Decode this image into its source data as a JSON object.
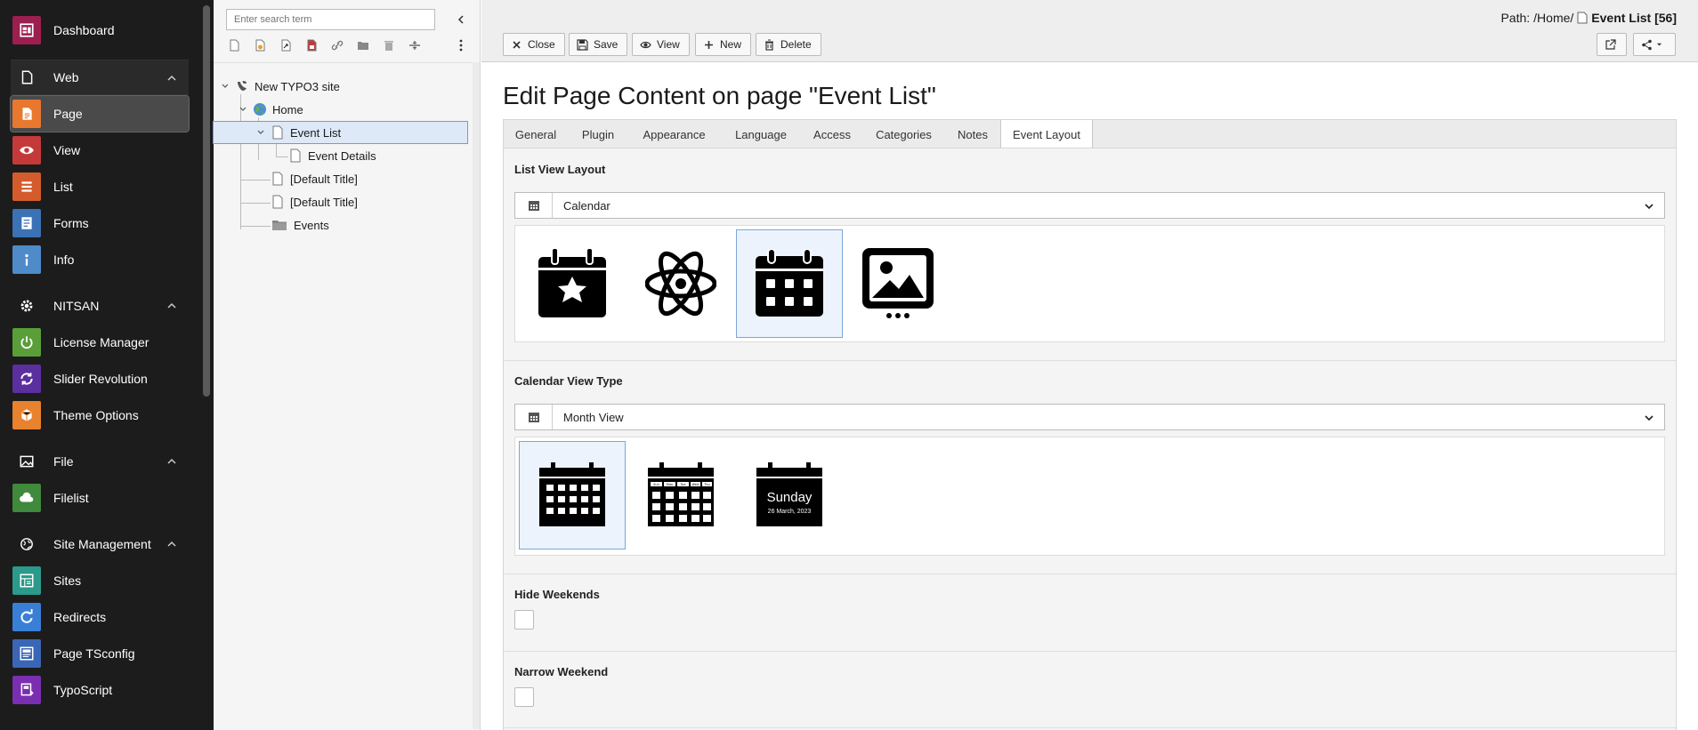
{
  "module_menu": {
    "items": [
      {
        "label": "Dashboard",
        "icon": "dashboard-icon",
        "color": "#9c1f4f",
        "type": "item"
      },
      {
        "label": "Web",
        "icon": "page-outline-icon",
        "type": "group"
      },
      {
        "label": "Page",
        "icon": "page-icon",
        "color": "#e8782e",
        "type": "item",
        "active": true
      },
      {
        "label": "View",
        "icon": "eye-icon",
        "color": "#c43a3a",
        "type": "item"
      },
      {
        "label": "List",
        "icon": "list-icon",
        "color": "#d45c2c",
        "type": "item"
      },
      {
        "label": "Forms",
        "icon": "forms-icon",
        "color": "#3a72b5",
        "type": "item"
      },
      {
        "label": "Info",
        "icon": "info-icon",
        "color": "#4f8bc9",
        "type": "item"
      },
      {
        "label": "NITSAN",
        "icon": "gear-icon",
        "type": "group"
      },
      {
        "label": "License Manager",
        "icon": "power-icon",
        "color": "#5a9e3a",
        "type": "item"
      },
      {
        "label": "Slider Revolution",
        "icon": "refresh-icon",
        "color": "#5b2f9e",
        "type": "item"
      },
      {
        "label": "Theme Options",
        "icon": "cube-icon",
        "color": "#e8822e",
        "type": "item"
      },
      {
        "label": "File",
        "icon": "image-icon",
        "type": "group"
      },
      {
        "label": "Filelist",
        "icon": "cloud-icon",
        "color": "#3f8a3c",
        "type": "item"
      },
      {
        "label": "Site Management",
        "icon": "globe-icon",
        "type": "group"
      },
      {
        "label": "Sites",
        "icon": "sites-icon",
        "color": "#2b9a8a",
        "type": "item"
      },
      {
        "label": "Redirects",
        "icon": "redirect-icon",
        "color": "#3a7fd6",
        "type": "item"
      },
      {
        "label": "Page TSconfig",
        "icon": "tsconfig-icon",
        "color": "#3a66b5",
        "type": "item"
      },
      {
        "label": "TypoScript",
        "icon": "typoscript-icon",
        "color": "#7a2fb0",
        "type": "item"
      }
    ]
  },
  "tree": {
    "search_placeholder": "Enter search term",
    "nodes": [
      {
        "label": "New TYPO3 site",
        "icon": "typo3-icon"
      },
      {
        "label": "Home",
        "icon": "globe-icon"
      },
      {
        "label": "Event List",
        "icon": "page-icon",
        "selected": true
      },
      {
        "label": "Event Details",
        "icon": "page-icon"
      },
      {
        "label": "[Default Title]",
        "icon": "page-icon"
      },
      {
        "label": "[Default Title]",
        "icon": "page-icon"
      },
      {
        "label": "Events",
        "icon": "folder-icon"
      }
    ]
  },
  "header": {
    "path_label": "Path:",
    "path_value": "/Home/",
    "page_title": "Event List [56]",
    "buttons": {
      "close": "Close",
      "save": "Save",
      "view": "View",
      "new": "New",
      "delete": "Delete"
    }
  },
  "editor": {
    "title": "Edit Page Content on page \"Event List\"",
    "tabs": [
      {
        "label": "General"
      },
      {
        "label": "Plugin"
      },
      {
        "label": "Appearance"
      },
      {
        "label": "Language"
      },
      {
        "label": "Access"
      },
      {
        "label": "Categories"
      },
      {
        "label": "Notes"
      },
      {
        "label": "Event Layout",
        "active": true
      }
    ],
    "list_view_layout": {
      "label": "List View Layout",
      "value": "Calendar",
      "options": [
        "calendar-star-icon",
        "atom-icon",
        "calendar-grid-icon",
        "image-gallery-icon"
      ],
      "selected_index": 2
    },
    "calendar_view_type": {
      "label": "Calendar View Type",
      "value": "Month View",
      "options": [
        "month-view-icon",
        "week-view-icon",
        "day-view-icon"
      ],
      "selected_index": 0,
      "day_preview": {
        "day": "Sunday",
        "date": "26 March, 2023"
      },
      "week_preview_days": [
        "Sun",
        "Mon",
        "Tue",
        "Wed",
        "Thu"
      ]
    },
    "hide_weekends": {
      "label": "Hide Weekends",
      "checked": false
    },
    "narrow_weekend": {
      "label": "Narrow Weekend",
      "checked": false
    }
  },
  "colors": {
    "accent": "#6a9fd6",
    "menu_bg": "#1c1c1c",
    "selected_bg": "#dde9f7"
  }
}
